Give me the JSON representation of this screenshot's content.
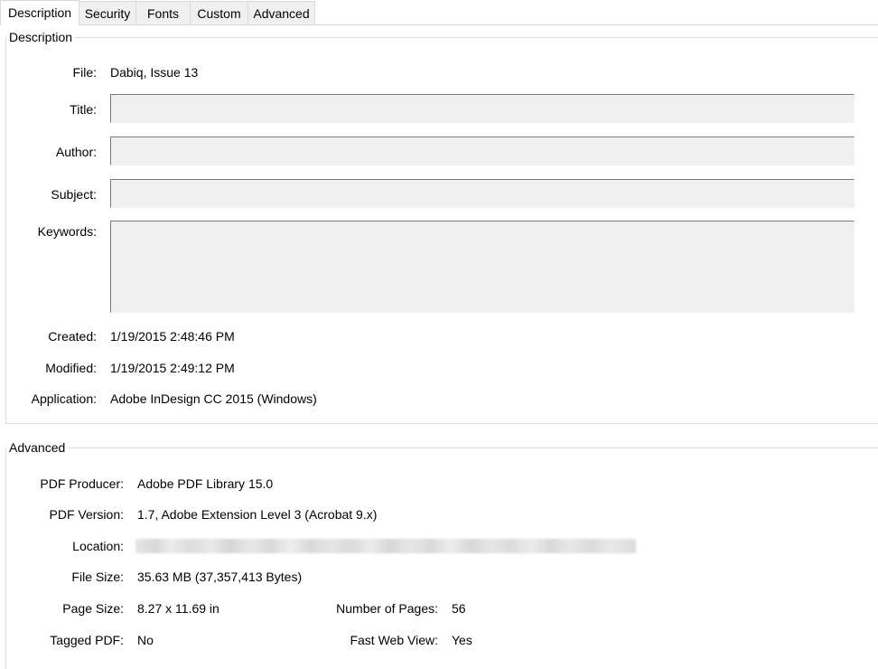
{
  "tabs": [
    {
      "label": "Description",
      "active": true
    },
    {
      "label": "Security",
      "active": false
    },
    {
      "label": "Fonts",
      "active": false
    },
    {
      "label": "Custom",
      "active": false
    },
    {
      "label": "Advanced",
      "active": false
    }
  ],
  "description": {
    "group_title": "Description",
    "file": {
      "label": "File:",
      "value": "Dabiq, Issue 13"
    },
    "title": {
      "label": "Title:",
      "value": ""
    },
    "author": {
      "label": "Author:",
      "value": ""
    },
    "subject": {
      "label": "Subject:",
      "value": ""
    },
    "keywords": {
      "label": "Keywords:",
      "value": ""
    },
    "created": {
      "label": "Created:",
      "value": "1/19/2015 2:48:46 PM"
    },
    "modified": {
      "label": "Modified:",
      "value": "1/19/2015 2:49:12 PM"
    },
    "application": {
      "label": "Application:",
      "value": "Adobe InDesign CC 2015 (Windows)"
    }
  },
  "advanced": {
    "group_title": "Advanced",
    "pdf_producer": {
      "label": "PDF Producer:",
      "value": "Adobe PDF Library 15.0"
    },
    "pdf_version": {
      "label": "PDF Version:",
      "value": "1.7, Adobe Extension Level 3 (Acrobat 9.x)"
    },
    "location": {
      "label": "Location:",
      "value_redacted": true
    },
    "file_size": {
      "label": "File Size:",
      "value": "35.63 MB (37,357,413 Bytes)"
    },
    "page_size": {
      "label": "Page Size:",
      "value": "8.27 x 11.69 in"
    },
    "num_pages": {
      "label": "Number of Pages:",
      "value": "56"
    },
    "tagged_pdf": {
      "label": "Tagged PDF:",
      "value": "No"
    },
    "fast_web_view": {
      "label": "Fast Web View:",
      "value": "Yes"
    }
  }
}
